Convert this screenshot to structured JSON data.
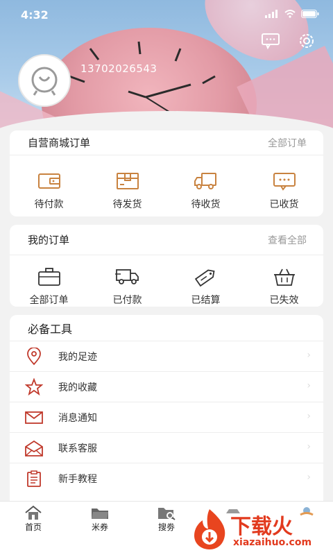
{
  "status_bar": {
    "time": "4:32"
  },
  "profile": {
    "phone": "13702026543"
  },
  "mall_orders": {
    "title": "自营商城订单",
    "all_link": "全部订单",
    "items": [
      {
        "label": "待付款",
        "icon": "wallet-icon"
      },
      {
        "label": "待发货",
        "icon": "package-icon"
      },
      {
        "label": "待收货",
        "icon": "truck-icon"
      },
      {
        "label": "已收货",
        "icon": "message-check-icon"
      }
    ]
  },
  "my_orders": {
    "title": "我的订单",
    "all_link": "查看全部",
    "items": [
      {
        "label": "全部订单",
        "icon": "briefcase-icon"
      },
      {
        "label": "已付款",
        "icon": "delivery-truck-icon"
      },
      {
        "label": "已结算",
        "icon": "tag-icon"
      },
      {
        "label": "已失效",
        "icon": "basket-icon"
      }
    ]
  },
  "tools": {
    "title": "必备工具",
    "items": [
      {
        "label": "我的足迹",
        "icon": "location-pin-icon"
      },
      {
        "label": "我的收藏",
        "icon": "star-icon"
      },
      {
        "label": "消息通知",
        "icon": "envelope-icon"
      },
      {
        "label": "联系客服",
        "icon": "open-envelope-icon"
      },
      {
        "label": "新手教程",
        "icon": "clipboard-icon"
      }
    ]
  },
  "tabbar": {
    "items": [
      {
        "label": "首页",
        "icon": "home-icon"
      },
      {
        "label": "米券",
        "icon": "folder-icon"
      },
      {
        "label": "搜劵",
        "icon": "search-folder-icon"
      }
    ]
  },
  "watermark": {
    "brand": "下载火",
    "site": "xiazaihuo.com"
  },
  "colors": {
    "accent": "#c8823f",
    "icon_red": "#c0392b",
    "text": "#333333",
    "muted": "#999999"
  }
}
